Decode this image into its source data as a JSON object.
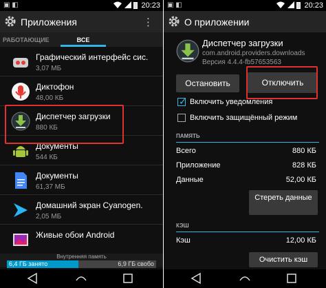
{
  "status_time": "20:23",
  "left": {
    "title": "Приложения",
    "overflow": "⋮",
    "tabs": {
      "running": "РАБОТАЮЩИЕ",
      "all": "ВСЕ"
    },
    "apps": [
      {
        "name": "Графический интерфейс сис.",
        "size": "3,07 МБ",
        "icon": "android-system-ui-icon"
      },
      {
        "name": "Диктофон",
        "size": "48,00 КБ",
        "icon": "microphone-icon"
      },
      {
        "name": "Диспетчер загрузки",
        "size": "880 КБ",
        "icon": "download-icon"
      },
      {
        "name": "Документы",
        "size": "544 КБ",
        "icon": "android-icon"
      },
      {
        "name": "Документы",
        "size": "61,37 МБ",
        "icon": "docs-icon"
      },
      {
        "name": "Домашний экран Cyanogen.",
        "size": "2,05 МБ",
        "icon": "cyanogen-launcher-icon"
      },
      {
        "name": "Живые обои Android",
        "size": "",
        "icon": "live-wallpaper-icon"
      }
    ],
    "storage": {
      "label": "Внутренняя память",
      "used": "6,4 ГБ занято",
      "free": "6,9 ГБ свобо",
      "used_fraction": 0.48
    }
  },
  "right": {
    "title": "О приложении",
    "app_name": "Диспетчер загрузки",
    "package": "com.android.providers.downloads",
    "version": "Версия 4.4.4-fb57653563",
    "stop_label": "Остановить",
    "disable_label": "Отключить",
    "notify_label": "Включить уведомления",
    "notify_checked": true,
    "protected_label": "Включить защищённый режим",
    "protected_checked": false,
    "memory_header": "ПАМЯТЬ",
    "memory_rows": [
      {
        "key": "Всего",
        "value": "880 КБ"
      },
      {
        "key": "Приложение",
        "value": "828 КБ"
      },
      {
        "key": "Данные",
        "value": "52,00 КБ"
      }
    ],
    "clear_data_label": "Стереть данные",
    "cache_header": "КЭШ",
    "cache_key": "Кэш",
    "cache_value": "12,00 КБ",
    "clear_cache_label": "Очистить кэш"
  },
  "colors": {
    "accent": "#33b5e5",
    "highlight": "#e03030",
    "download_green": "#8bc34a"
  }
}
